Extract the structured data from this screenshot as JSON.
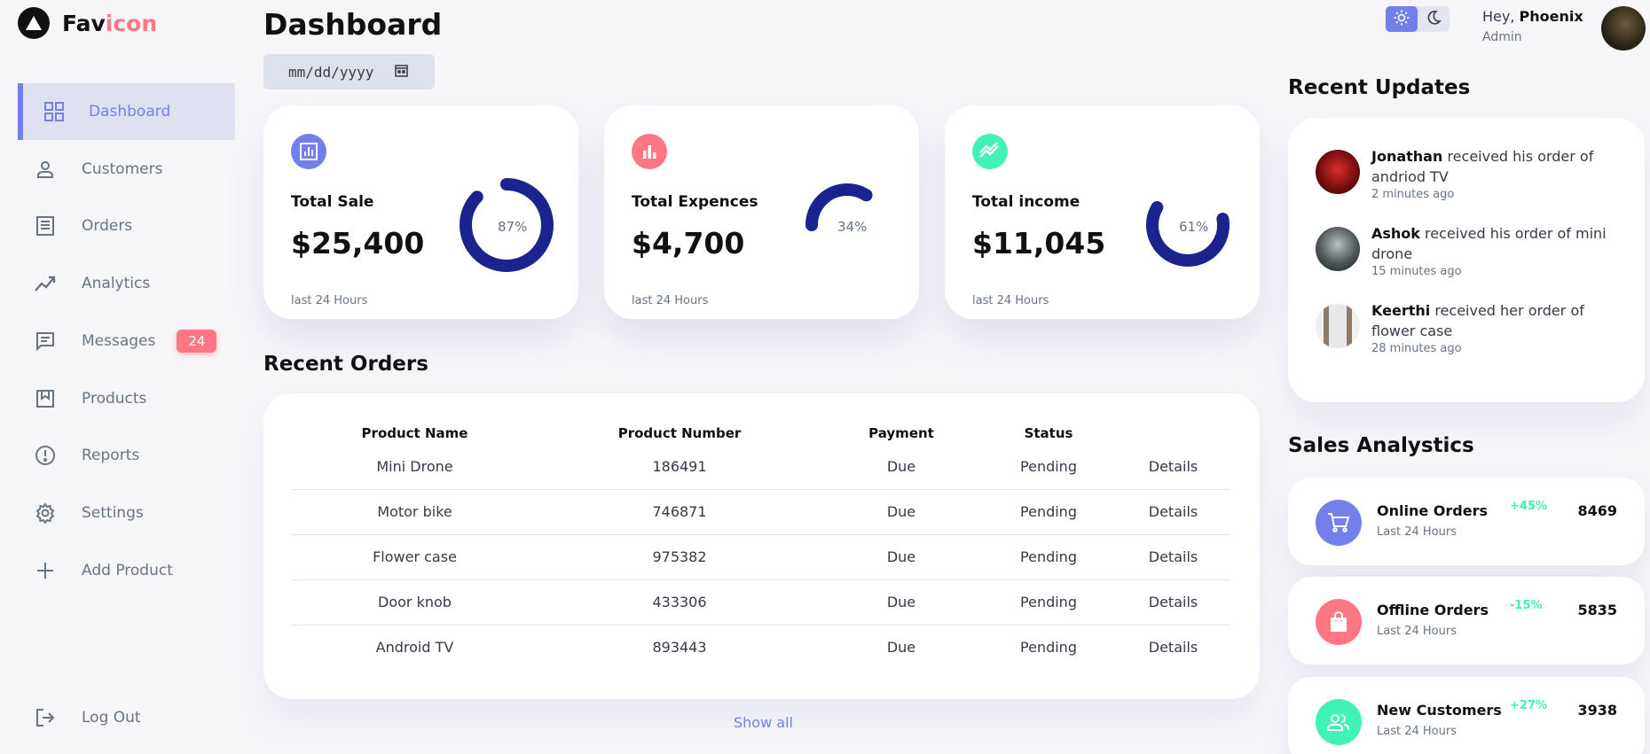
{
  "brand": {
    "name_primary": "Fav",
    "name_accent": "icon"
  },
  "sidebar": {
    "items": [
      {
        "label": "Dashboard",
        "icon": "grid-icon"
      },
      {
        "label": "Customers",
        "icon": "person-icon"
      },
      {
        "label": "Orders",
        "icon": "receipt-icon"
      },
      {
        "label": "Analytics",
        "icon": "trend-icon"
      },
      {
        "label": "Messages",
        "icon": "chat-icon",
        "badge": "24"
      },
      {
        "label": "Products",
        "icon": "inventory-icon"
      },
      {
        "label": "Reports",
        "icon": "warning-icon"
      },
      {
        "label": "Settings",
        "icon": "gear-icon"
      },
      {
        "label": "Add Product",
        "icon": "plus-icon"
      }
    ],
    "logout": "Log Out"
  },
  "main": {
    "title": "Dashboard",
    "date_placeholder": "mm/dd/yyyy",
    "cards": [
      {
        "label": "Total Sale",
        "value": "$25,400",
        "percent": "87%",
        "progress": 0.87,
        "foot": "last 24 Hours",
        "icon_color": "#7380ec"
      },
      {
        "label": "Total Expences",
        "value": "$4,700",
        "percent": "34%",
        "progress": 0.34,
        "foot": "last 24 Hours",
        "icon_color": "#ff7782"
      },
      {
        "label": "Total income",
        "value": "$11,045",
        "percent": "61%",
        "progress": 0.61,
        "foot": "last 24 Hours",
        "icon_color": "#41f1b6"
      }
    ],
    "recent_orders": {
      "title": "Recent Orders",
      "headers": [
        "Product Name",
        "Product Number",
        "Payment",
        "Status",
        ""
      ],
      "rows": [
        [
          "Mini Drone",
          "186491",
          "Due",
          "Pending",
          "Details"
        ],
        [
          "Motor bike",
          "746871",
          "Due",
          "Pending",
          "Details"
        ],
        [
          "Flower case",
          "975382",
          "Due",
          "Pending",
          "Details"
        ],
        [
          "Door knob",
          "433306",
          "Due",
          "Pending",
          "Details"
        ],
        [
          "Android TV",
          "893443",
          "Due",
          "Pending",
          "Details"
        ]
      ],
      "show_all": "Show all"
    }
  },
  "right": {
    "greeting": "Hey,",
    "user_name": "Phoenix",
    "role": "Admin",
    "updates_title": "Recent Updates",
    "updates": [
      {
        "name": "Jonathan",
        "text": "received his order of andriod TV",
        "time": "2 minutes ago"
      },
      {
        "name": "Ashok",
        "text": "received his order of mini drone",
        "time": "15 minutes ago"
      },
      {
        "name": "Keerthi",
        "text": "received her order of flower case",
        "time": "28 minutes ago"
      }
    ],
    "analytics_title": "Sales Analystics",
    "analytics": [
      {
        "title": "Online Orders",
        "sub": "Last 24 Hours",
        "pct": "+45%",
        "value": "8469",
        "color": "#7380ec",
        "icon": "cart-icon"
      },
      {
        "title": "Offline Orders",
        "sub": "Last 24 Hours",
        "pct": "-15%",
        "value": "5835",
        "color": "#ff7782",
        "icon": "bag-icon"
      },
      {
        "title": "New Customers",
        "sub": "Last 24 Hours",
        "pct": "+27%",
        "value": "3938",
        "color": "#41f1b6",
        "icon": "people-icon"
      }
    ]
  }
}
